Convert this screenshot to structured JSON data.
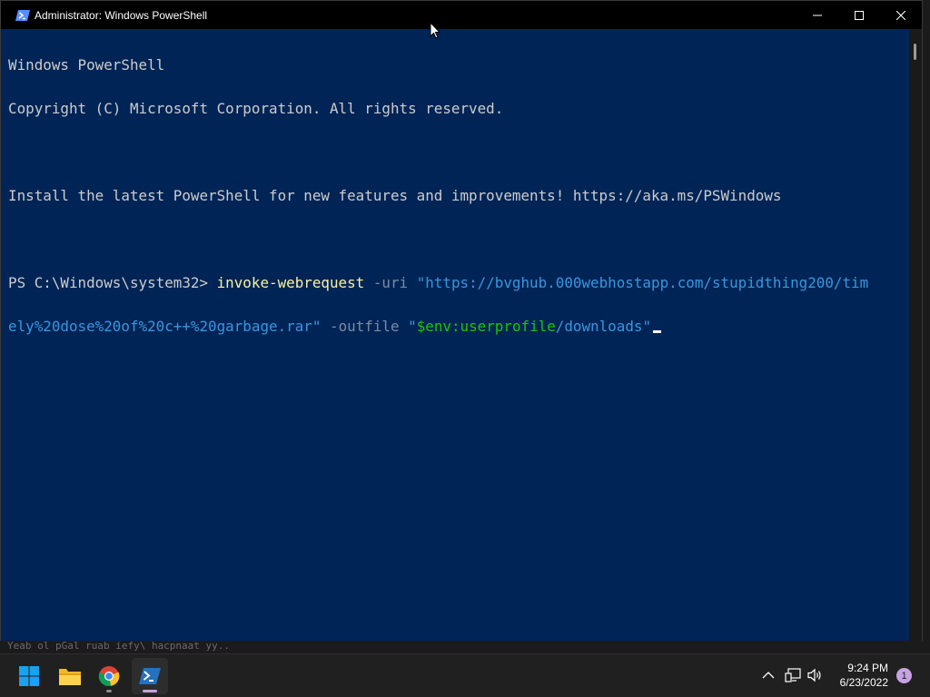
{
  "window": {
    "title": "Administrator: Windows PowerShell",
    "icon": "powershell-icon",
    "background": "#012456"
  },
  "console": {
    "lines": [
      "Windows PowerShell",
      "Copyright (C) Microsoft Corporation. All rights reserved.",
      "",
      "Install the latest PowerShell for new features and improvements! https://aka.ms/PSWindows",
      ""
    ],
    "prompt": "PS C:\\Windows\\system32> ",
    "command": "invoke-webrequest",
    "param_uri": "-uri",
    "uri_line1": "\"https://bvghub.000webhostapp.com/stupidthing200/tim",
    "uri_line2": "ely%20dose%20of%20c++%20garbage.rar\"",
    "param_outfile": "-outfile",
    "outfile_q1": "\"",
    "outfile_var": "$env:userprofile",
    "outfile_rest": "/downloads\""
  },
  "background_text": "Yeab ol pGal ruab iefy\\ hacpnaat yy..",
  "taskbar": {
    "apps": [
      {
        "name": "start-button",
        "icon": "windows-icon"
      },
      {
        "name": "file-explorer",
        "icon": "folder-icon"
      },
      {
        "name": "chrome",
        "icon": "chrome-icon"
      },
      {
        "name": "powershell",
        "icon": "powershell-icon"
      }
    ],
    "clock": {
      "time": "9:24 PM",
      "date": "6/23/2022"
    },
    "notifications": "1"
  },
  "colors": {
    "command": "#f9f1a5",
    "parameter": "#7a8ba3",
    "string": "#3a96dd",
    "variable": "#16c60c",
    "taskbar": "#202020"
  }
}
